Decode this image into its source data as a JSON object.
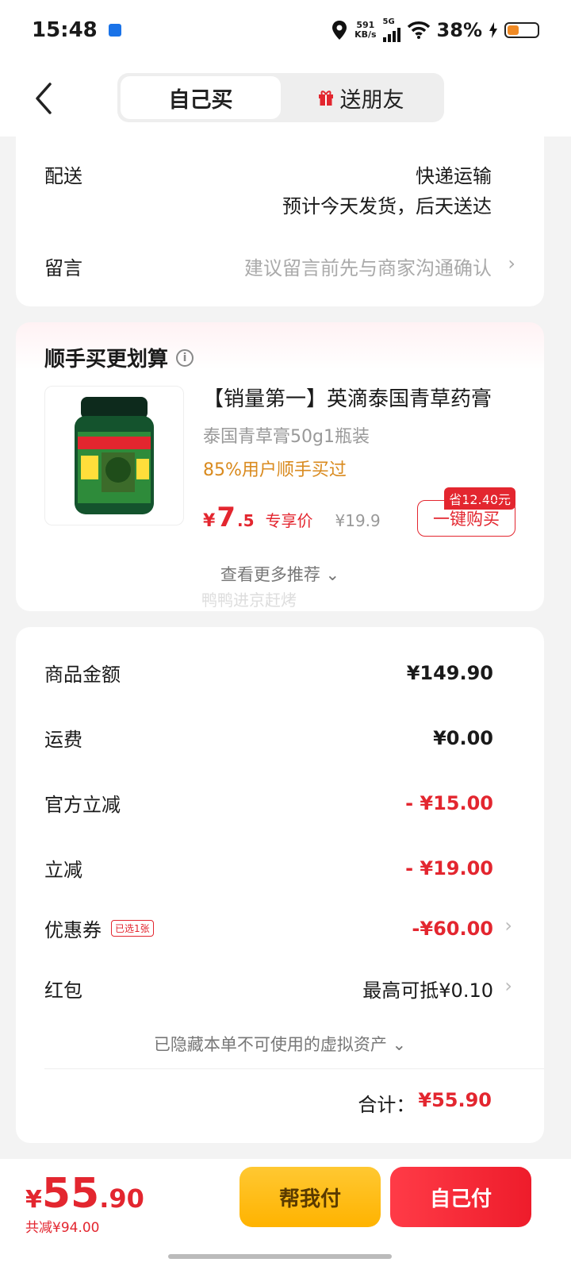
{
  "status_bar": {
    "time": "15:48",
    "net_speed_value": "591",
    "net_speed_unit": "KB/s",
    "network": "5G",
    "battery": "38%"
  },
  "nav": {
    "tab_self": "自己买",
    "tab_gift": "送朋友"
  },
  "delivery": {
    "label": "配送",
    "method": "快递运输",
    "eta": "预计今天发货，后天送达"
  },
  "message": {
    "label": "留言",
    "placeholder": "建议留言前先与商家沟通确认"
  },
  "upsell": {
    "title": "顺手买更划算",
    "product_title": "【销量第一】英滴泰国青草药膏",
    "product_sub": "泰国青草膏50g1瓶装",
    "hint": "85%用户顺手买过",
    "price_currency": "¥",
    "price_int": "7",
    "price_dec": ".5",
    "price_tag": "专享价",
    "old_price": "¥19.9",
    "save_badge": "省12.40元",
    "buy_button": "一键购买",
    "more": "查看更多推荐",
    "watermark": "鸭鸭进京赶烤"
  },
  "summary": {
    "goods_label": "商品金额",
    "goods_value": "¥149.90",
    "shipping_label": "运费",
    "shipping_value": "¥0.00",
    "official_label": "官方立减",
    "official_value": "- ¥15.00",
    "instant_label": "立减",
    "instant_value": "- ¥19.00",
    "coupon_label": "优惠券",
    "coupon_badge": "已选1张",
    "coupon_value": "-¥60.00",
    "redpacket_label": "红包",
    "redpacket_value": "最高可抵¥0.10",
    "hidden_note": "已隐藏本单不可使用的虚拟资产",
    "total_label": "合计：",
    "total_value": "¥55.90"
  },
  "bottom": {
    "currency": "¥",
    "total_int": "55",
    "total_dec": ".90",
    "saved": "共减¥94.00",
    "help_pay": "帮我付",
    "self_pay": "自己付"
  },
  "colors": {
    "accent_red": "#e3262f",
    "help_yellow": "#ffb300",
    "hint_orange": "#d98a1e"
  }
}
